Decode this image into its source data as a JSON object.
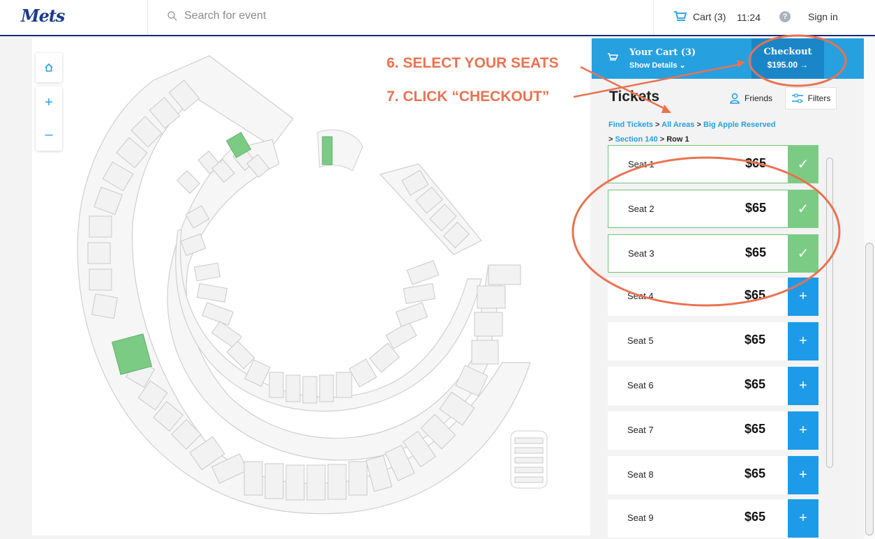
{
  "header": {
    "logo": "Mets",
    "search_placeholder": "Search for event",
    "cart_label": "Cart (3)",
    "time": "11:24",
    "help": "?",
    "signin": "Sign in"
  },
  "cart": {
    "title": "Your Cart (3)",
    "details": "Show Details",
    "checkout_label": "Checkout",
    "checkout_amount": "$195.00 →"
  },
  "panel": {
    "heading": "Tickets",
    "friends": "Friends",
    "filters": "Filters",
    "breadcrumb": [
      "Find Tickets",
      "All Areas",
      "Big Apple Reserved",
      "Section 140",
      "Row 1"
    ],
    "crumb_sep": ">"
  },
  "seats": [
    {
      "label": "Seat 1",
      "price": "$65",
      "selected": true,
      "action": "✓"
    },
    {
      "label": "Seat 2",
      "price": "$65",
      "selected": true,
      "action": "✓"
    },
    {
      "label": "Seat 3",
      "price": "$65",
      "selected": true,
      "action": "✓"
    },
    {
      "label": "Seat 4",
      "price": "$65",
      "selected": false,
      "action": "+"
    },
    {
      "label": "Seat 5",
      "price": "$65",
      "selected": false,
      "action": "+"
    },
    {
      "label": "Seat 6",
      "price": "$65",
      "selected": false,
      "action": "+"
    },
    {
      "label": "Seat 7",
      "price": "$65",
      "selected": false,
      "action": "+"
    },
    {
      "label": "Seat 8",
      "price": "$65",
      "selected": false,
      "action": "+"
    },
    {
      "label": "Seat 9",
      "price": "$65",
      "selected": false,
      "action": "+"
    }
  ],
  "map_controls": {
    "zoom_in": "+",
    "zoom_out": "–"
  },
  "annotations": {
    "step6": "6. SELECT YOUR SEATS",
    "step7": "7. CLICK “CHECKOUT”"
  },
  "colors": {
    "accent": "#27a0e0",
    "selected": "#7ccb85",
    "annotation": "#ea7250",
    "brand": "#1b2a78"
  }
}
